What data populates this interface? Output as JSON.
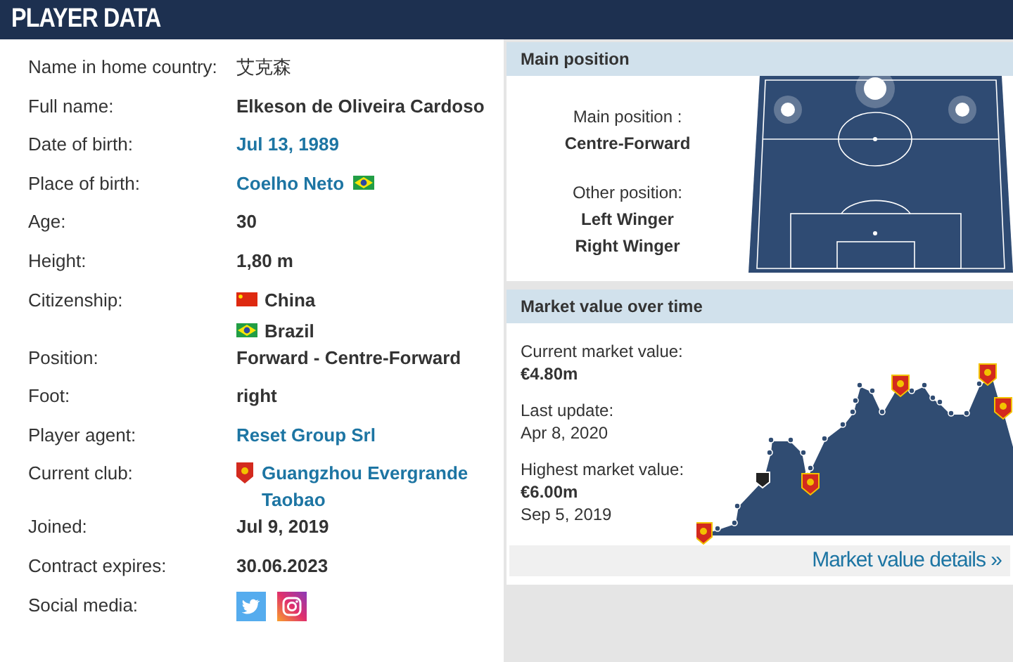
{
  "header": {
    "title": "PLAYER DATA"
  },
  "rows": [
    {
      "label": "Name in home country:",
      "kind": "native",
      "value": "艾克森"
    },
    {
      "label": "Full name:",
      "kind": "plain",
      "value": "Elkeson de Oliveira Cardoso"
    },
    {
      "label": "Date of birth:",
      "kind": "link",
      "value": "Jul 13, 1989"
    },
    {
      "label": "Place of birth:",
      "kind": "place",
      "value": "Coelho Neto",
      "birth_flag": {
        "kind": "br"
      }
    },
    {
      "label": "Age:",
      "kind": "plain",
      "value": "30"
    },
    {
      "label": "Height:",
      "kind": "plain",
      "value": "1,80 m"
    },
    {
      "label": "Citizenship:",
      "kind": "countries",
      "countries": [
        {
          "name": "China",
          "kind": "cn"
        },
        {
          "name": "Brazil",
          "kind": "br"
        }
      ]
    },
    {
      "label": "Position:",
      "kind": "plain",
      "value": "Forward - Centre-Forward"
    },
    {
      "label": "Foot:",
      "kind": "plain",
      "value": "right"
    },
    {
      "label": "Player agent:",
      "kind": "link",
      "value": "Reset Group Srl"
    },
    {
      "label": "Current club:",
      "kind": "club",
      "value": "Guangzhou Evergrande Taobao"
    },
    {
      "label": "Joined:",
      "kind": "plain",
      "value": "Jul 9, 2019"
    },
    {
      "label": "Contract expires:",
      "kind": "plain",
      "value": "30.06.2023"
    },
    {
      "label": "Social media:",
      "kind": "social",
      "links": [
        {
          "kind": "twitter"
        },
        {
          "kind": "instagram"
        }
      ]
    }
  ],
  "main_position": {
    "title": "Main position",
    "main_label": "Main position :",
    "main": "Centre-Forward",
    "other_label": "Other position:",
    "others": [
      "Left Winger",
      "Right Winger"
    ]
  },
  "market_value": {
    "title": "Market value over time",
    "current_label": "Current market value:",
    "current": "€4.80m",
    "update_label": "Last update:",
    "update": "Apr 8, 2020",
    "highest_label": "Highest market value:",
    "highest": "€6.00m",
    "highest_date": "Sep 5, 2019",
    "details_link": "Market value details »"
  }
}
